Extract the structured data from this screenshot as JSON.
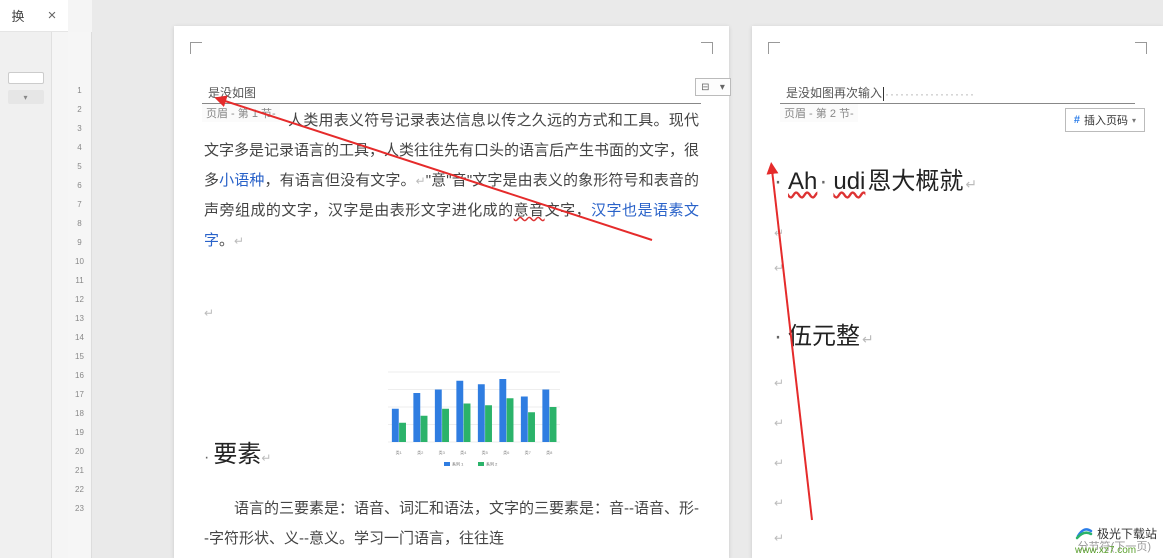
{
  "topbar": {
    "replace_label": "换",
    "close_label": "×"
  },
  "ruler": {
    "ticks": [
      "",
      "1",
      "2",
      "3",
      "4",
      "5",
      "6",
      "7",
      "8",
      "9",
      "10",
      "11",
      "12",
      "13",
      "14",
      "15",
      "16",
      "17",
      "18",
      "19",
      "20",
      "21",
      "22",
      "23"
    ]
  },
  "page1": {
    "header_text": "是没如图",
    "header_section_label": "页眉 - 第 1 节-",
    "header_tool_icon": "⊟",
    "para1_prefix": "人类用表义符号记录表达信息以传之久远的方式和工具。现代文字多是记录语言的工具，人类往往先有口头的语言后产生书面的文字，很多",
    "para1_link1": "小语种",
    "para1_mid1": "，有语言但没有文字。",
    "para1_quoted": "\"意\"音\"",
    "para1_mid2": "文字是由表义的象形符号和表音的声旁组成的文字，汉字是由表形文字进化成的",
    "para1_under": "意音",
    "para1_mid3": "文字，",
    "para1_link2": "汉字也是语素文字",
    "para1_end": "。",
    "heading": "要素",
    "para2": "语言的三要素是：语音、词汇和语法，文字的三要素是：音--语音、形--字符形状、义--意义。学习一门语言，往往连"
  },
  "page2": {
    "header_text": "是没如图再次输入",
    "header_section_label": "页眉 - 第 2 节-",
    "insert_button_label": "插入页码",
    "heading1_a": "Ah",
    "heading1_b": "udi",
    "heading1_c": " 恩大概就",
    "heading2": "伍元整",
    "break_label": "分节符(下一页)"
  },
  "chart_data": {
    "type": "bar",
    "categories": [
      "类1",
      "类2",
      "类3",
      "类4",
      "类5",
      "类6",
      "类7",
      "类8"
    ],
    "series": [
      {
        "name": "系列 1",
        "color": "#2f7de1",
        "values": [
          38,
          56,
          60,
          70,
          66,
          72,
          52,
          60
        ]
      },
      {
        "name": "系列 2",
        "color": "#2bb36a",
        "values": [
          22,
          30,
          38,
          44,
          42,
          50,
          34,
          40
        ]
      }
    ],
    "ylim": [
      0,
      80
    ]
  },
  "watermark": {
    "brand": "极光下载站",
    "url": "www.xz7.com"
  }
}
